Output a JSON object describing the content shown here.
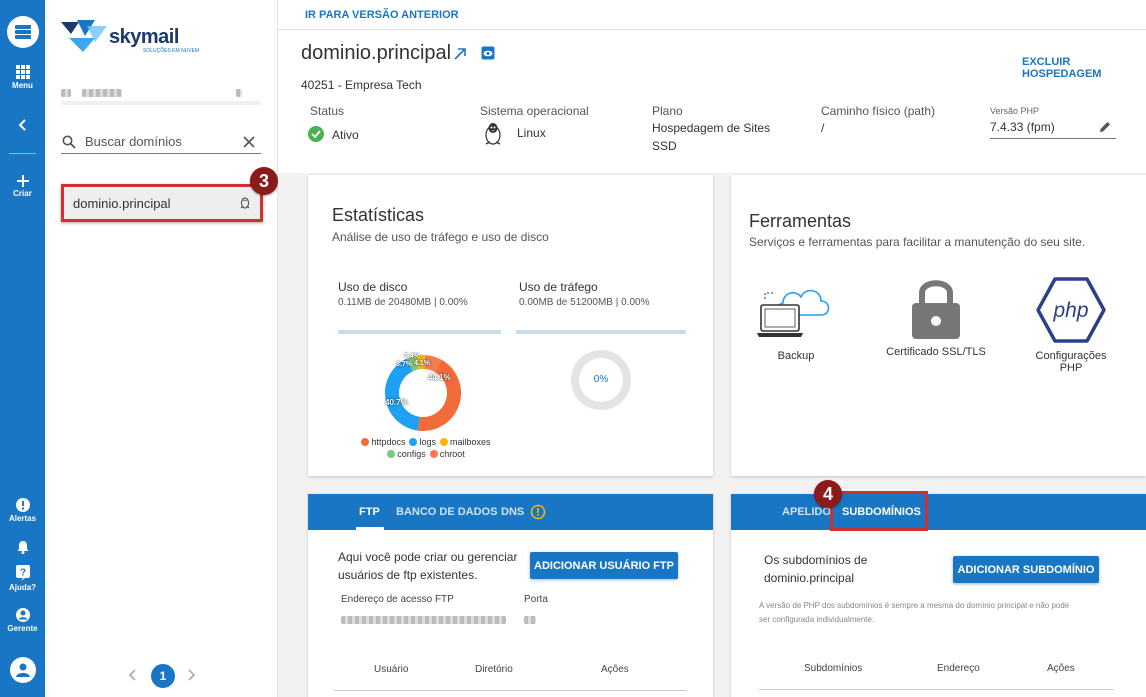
{
  "rail": {
    "menu_label": "Menu",
    "create_label": "Criar",
    "alerts_label": "Alertas",
    "help_label": "Ajuda?",
    "manager_label": "Gerente"
  },
  "brand": {
    "name": "skymail",
    "tagline": "SOLUÇÕES EM NUVEM"
  },
  "sidebar": {
    "search_placeholder": "Buscar domínios",
    "domain": "dominio.principal",
    "page": "1"
  },
  "badges": {
    "b3": "3",
    "b4": "4"
  },
  "topbar": {
    "prev_version": "IR PARA VERSÃO ANTERIOR"
  },
  "header": {
    "domain_title": "dominio.principal",
    "customer": "40251 - Empresa Tech",
    "delete_hosting": "EXCLUIR HOSPEDAGEM",
    "status_label": "Status",
    "status_value": "Ativo",
    "os_label": "Sistema operacional",
    "os_value": "Linux",
    "plan_label": "Plano",
    "plan_value_1": "Hospedagem de Sites",
    "plan_value_2": "SSD",
    "path_label": "Caminho físico (path)",
    "path_value": "/",
    "php_label": "Versão PHP",
    "php_value": "7.4.33 (fpm)"
  },
  "stats": {
    "title": "Estatísticas",
    "subtitle": "Análise de uso de tráfego e uso de disco",
    "disk_title": "Uso de disco",
    "disk_detail": "0.11MB de 20480MB | 0.00%",
    "traffic_title": "Uso de tráfego",
    "traffic_detail": "0.00MB de 51200MB | 0.00%",
    "traffic_pct": "0%",
    "pie_label_httpdocs": "44.1%",
    "pie_label_logs": "40.7%",
    "pie_label_small1": "7.4%",
    "pie_label_small2": "3.7%",
    "pie_label_small3": "4.1%"
  },
  "chart_data": {
    "type": "pie",
    "title": "",
    "slices": [
      {
        "name": "httpdocs",
        "value": 44.1,
        "color": "#f26b3a"
      },
      {
        "name": "logs",
        "value": 40.7,
        "color": "#1ea1f2"
      },
      {
        "name": "mailboxes",
        "value": 3.7,
        "color": "#f5b800"
      },
      {
        "name": "configs",
        "value": 4.1,
        "color": "#7ec87a"
      },
      {
        "name": "chroot",
        "value": 7.4,
        "color": "#f27b50"
      }
    ],
    "legend": [
      "httpdocs",
      "logs",
      "mailboxes",
      "configs",
      "chroot"
    ],
    "legend_position": "bottom"
  },
  "tools": {
    "title": "Ferramentas",
    "subtitle": "Serviços e ferramentas para facilitar a manutenção do seu site.",
    "backup": "Backup",
    "ssl": "Certificado SSL/TLS",
    "php": "Configurações PHP",
    "php_logo_text": "php"
  },
  "ftp": {
    "tab_ftp": "FTP",
    "tab_db": "BANCO DE DADOS",
    "tab_dns": "DNS",
    "description_1": "Aqui você pode criar ou gerenciar",
    "description_2": "usuários de ftp existentes.",
    "add_button": "ADICIONAR USUÁRIO FTP",
    "address_label": "Endereço de acesso FTP",
    "port_label": "Porta",
    "col_user": "Usuário",
    "col_dir": "Diretório",
    "col_actions": "Ações"
  },
  "sub": {
    "tab_alias": "APELIDO",
    "tab_sub": "SUBDOMÍNIOS",
    "description_1": "Os subdomínios de",
    "description_2": "dominio.principal",
    "add_button": "ADICIONAR SUBDOMÍNIO",
    "note_1": "A versão de PHP dos subdomínios é sempre a mesma do domínio principal e não pode",
    "note_2": "ser configurada individualmente.",
    "col_sub": "Subdomínios",
    "col_addr": "Endereço",
    "col_actions": "Ações"
  },
  "colors": {
    "primary": "#1976c5",
    "annotation": "#d32f2f",
    "badge": "#8b1a1a",
    "success": "#4caf50"
  }
}
